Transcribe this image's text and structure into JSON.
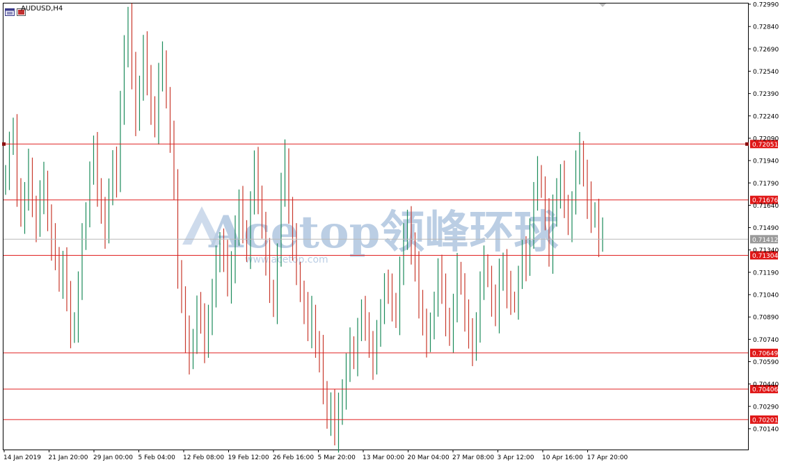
{
  "window": {
    "symbol_title": "AUDUSD,H4",
    "watermark_brand": "Acetop领峰环球",
    "watermark_url": "www.acetop.com"
  },
  "colors": {
    "bull_candle": "#1a8a5a",
    "bear_candle": "#c8382c",
    "level_line": "#e02020",
    "price_line": "#b8b8b8",
    "level_label_bg": "#e01818",
    "price_label_bg": "#9a9a9a",
    "watermark": "#b4c9e2"
  },
  "chart_data": {
    "type": "candlestick",
    "symbol": "AUDUSD",
    "timeframe": "H4",
    "ylim": [
      0.7004,
      0.7299
    ],
    "y_ticks": [
      "0.72990",
      "0.72840",
      "0.72690",
      "0.72540",
      "0.72390",
      "0.72240",
      "0.72090",
      "0.71940",
      "0.71790",
      "0.71640",
      "0.71490",
      "0.71340",
      "0.71190",
      "0.71040",
      "0.70890",
      "0.70740",
      "0.70590",
      "0.70440",
      "0.70290",
      "0.70140"
    ],
    "x_ticks": [
      "14 Jan 2019",
      "21 Jan 20:00",
      "29 Jan 00:00",
      "5 Feb 04:00",
      "12 Feb 08:00",
      "19 Feb 12:00",
      "26 Feb 16:00",
      "5 Mar 20:00",
      "13 Mar 00:00",
      "20 Mar 04:00",
      "27 Mar 08:00",
      "3 Apr 12:00",
      "10 Apr 16:00",
      "17 Apr 20:00"
    ],
    "horizontal_levels": [
      "0.72051",
      "0.71676",
      "0.71304",
      "0.70649",
      "0.70406",
      "0.70201"
    ],
    "current_price": "0.71412",
    "closes": [
      0.7185,
      0.7205,
      0.7212,
      0.7175,
      0.7158,
      0.717,
      0.719,
      0.7162,
      0.715,
      0.717,
      0.718,
      0.7155,
      0.714,
      0.713,
      0.7112,
      0.7125,
      0.71,
      0.708,
      0.7085,
      0.711,
      0.714,
      0.716,
      0.7185,
      0.72,
      0.7175,
      0.716,
      0.7148,
      0.717,
      0.7195,
      0.718,
      0.723,
      0.7265,
      0.729,
      0.7255,
      0.722,
      0.7245,
      0.727,
      0.7245,
      0.723,
      0.7218,
      0.725,
      0.7262,
      0.7235,
      0.721,
      0.7175,
      0.712,
      0.71,
      0.7078,
      0.706,
      0.7075,
      0.7095,
      0.7085,
      0.707,
      0.709,
      0.7105,
      0.7125,
      0.714,
      0.713,
      0.711,
      0.712,
      0.715,
      0.7165,
      0.7148,
      0.7132,
      0.7165,
      0.719,
      0.717,
      0.715,
      0.713,
      0.7108,
      0.7095,
      0.713,
      0.7175,
      0.7195,
      0.716,
      0.714,
      0.712,
      0.7105,
      0.7095,
      0.708,
      0.709,
      0.707,
      0.7065,
      0.704,
      0.702,
      0.703,
      0.701,
      0.7025,
      0.704,
      0.7055,
      0.707,
      0.706,
      0.708,
      0.709,
      0.7085,
      0.707,
      0.706,
      0.7075,
      0.7095,
      0.711,
      0.7105,
      0.7098,
      0.709,
      0.712,
      0.714,
      0.7155,
      0.7135,
      0.712,
      0.71,
      0.7085,
      0.7075,
      0.708,
      0.71,
      0.712,
      0.7105,
      0.7088,
      0.7078,
      0.7095,
      0.712,
      0.711,
      0.709,
      0.7075,
      0.7068,
      0.7085,
      0.711,
      0.7125,
      0.7115,
      0.71,
      0.709,
      0.7115,
      0.7125,
      0.7108,
      0.71,
      0.7098,
      0.7115,
      0.713,
      0.7125,
      0.7148,
      0.717,
      0.7185,
      0.7175,
      0.7158,
      0.713,
      0.7158,
      0.7175,
      0.7182,
      0.7165,
      0.715,
      0.7165,
      0.719,
      0.72,
      0.7185,
      0.7168,
      0.7155,
      0.716,
      0.714,
      0.7145
    ]
  }
}
